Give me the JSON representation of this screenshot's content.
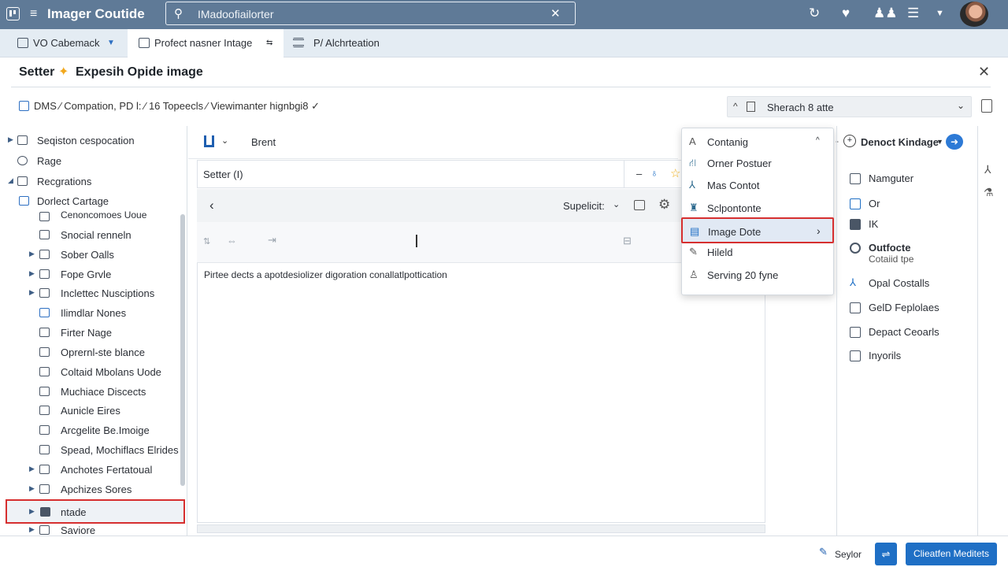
{
  "app": {
    "title": "Imager Coutide"
  },
  "search": {
    "placeholder": "IMadoofiailorter"
  },
  "tabs": [
    {
      "label": "VO Cabemack"
    },
    {
      "label": "Profect nasner Intage"
    },
    {
      "label": "P/  Alchrteation"
    }
  ],
  "header": {
    "title_a": "Setter",
    "title_b": "Expesih  Opide image"
  },
  "breadcrumb": {
    "text": "DMS ⁄ Compation,  PD l: ⁄ 16 Topeecls   ⁄ Viewimanter hignbgi8 ✓"
  },
  "selector": {
    "label": "Sherach 8 atte"
  },
  "tree": [
    {
      "label": "Seqiston cespocation",
      "arrow": true
    },
    {
      "label": "Rage",
      "arrow": false
    },
    {
      "label": "Recgrations",
      "arrow": true
    },
    {
      "label": "Dorlect Cartage",
      "arrow": false
    },
    {
      "label": "Cenoncomoes Uoue",
      "arrow": false
    },
    {
      "label": "Snocial renneln",
      "arrow": false
    },
    {
      "label": "Sober Oalls",
      "arrow": true
    },
    {
      "label": "Fope Grvle",
      "arrow": true
    },
    {
      "label": "Inclettec Nusciptions",
      "arrow": true
    },
    {
      "label": "Ilimdlar Nones",
      "arrow": false
    },
    {
      "label": "Firter Nage",
      "arrow": false
    },
    {
      "label": "Oprernl-ste blance",
      "arrow": false
    },
    {
      "label": "Coltaid Mbolans Uode",
      "arrow": false
    },
    {
      "label": "Muchiace Discects",
      "arrow": false
    },
    {
      "label": "Aunicle Eires",
      "arrow": false
    },
    {
      "label": "Arcgelite Be.Imoige",
      "arrow": false
    },
    {
      "label": "Spead, Mochiflacs Elrides",
      "arrow": false
    },
    {
      "label": "Anchotes Fertatoual",
      "arrow": true
    },
    {
      "label": "Apchizes Sores",
      "arrow": true
    },
    {
      "label": "ntade",
      "arrow": true
    },
    {
      "label": "Saviore",
      "arrow": true
    }
  ],
  "center": {
    "toolbar_label": "Brent",
    "tab_label": "Setter (I)",
    "nav_label": "Supelicit:",
    "body_text": "Pirtee dects a apotdesiolizer digoration conallatlpottication"
  },
  "dropdown": [
    {
      "icon": "A",
      "label": "Contanig",
      "chevron": "up"
    },
    {
      "icon": "⛙",
      "label": "Orner Postuer"
    },
    {
      "icon": "⅄",
      "label": "Mas Contot"
    },
    {
      "icon": "♜",
      "label": "Sclpontonte"
    },
    {
      "icon": "▤",
      "label": "Image Dote",
      "chevron": "right",
      "selected": true
    },
    {
      "icon": "✎",
      "label": "Hileld"
    },
    {
      "icon": "♙",
      "label": "Serving 20 fyne"
    }
  ],
  "rightpanel": {
    "header": "Denoct Kindage",
    "items": [
      {
        "label": "Namguter"
      },
      {
        "label": "Or"
      },
      {
        "label": "IK"
      },
      {
        "label": "Outfocte",
        "sub": "Cotaiid tpe"
      },
      {
        "label": "Opal Costalls"
      },
      {
        "label": "GelD Feplolaes"
      },
      {
        "label": "Depact Ceoarls"
      },
      {
        "label": "Inyorils"
      }
    ]
  },
  "footer": {
    "link": "Seylor",
    "primary": "Clieatfen Meditets"
  }
}
